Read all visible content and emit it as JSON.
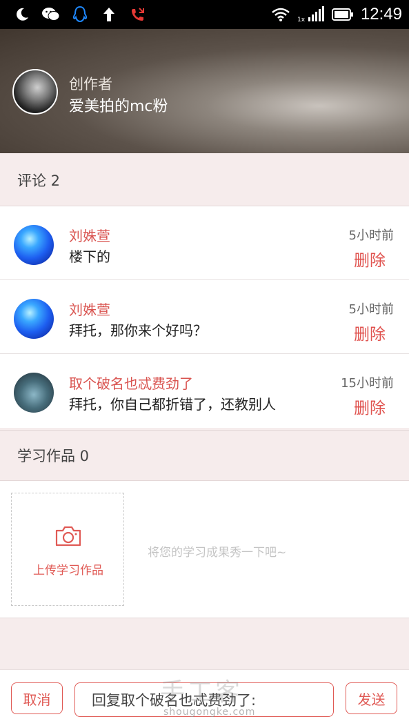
{
  "status_bar": {
    "time": "12:49",
    "icons": [
      "moon-icon",
      "wechat-icon",
      "qq-icon",
      "upload-arrow-icon",
      "missed-call-icon",
      "wifi-icon",
      "signal-icon",
      "battery-icon"
    ]
  },
  "author": {
    "role": "创作者",
    "name": "爱美拍的mc粉"
  },
  "comments_section": {
    "title": "评论 2",
    "items": [
      {
        "name": "刘姝萱",
        "text": "楼下的",
        "time": "5小时前",
        "action": "删除"
      },
      {
        "name": "刘姝萱",
        "text": "拜托，那你来个好吗？",
        "time": "5小时前",
        "action": "删除"
      },
      {
        "name": "取个破名也忒费劲了",
        "text": "拜托，你自己都折错了，还教别人",
        "time": "15小时前",
        "action": "删除"
      }
    ]
  },
  "works_section": {
    "title": "学习作品 0",
    "upload_label": "上传学习作品",
    "hint": "将您的学习成果秀一下吧~"
  },
  "reply_bar": {
    "cancel_label": "取消",
    "input_value": "回复取个破名也忒费劲了:",
    "send_label": "发送"
  },
  "watermark": {
    "text": "手工客",
    "url": "shougongke.com"
  },
  "colors": {
    "accent": "#e05a55",
    "section_bg": "#f6ecec"
  }
}
